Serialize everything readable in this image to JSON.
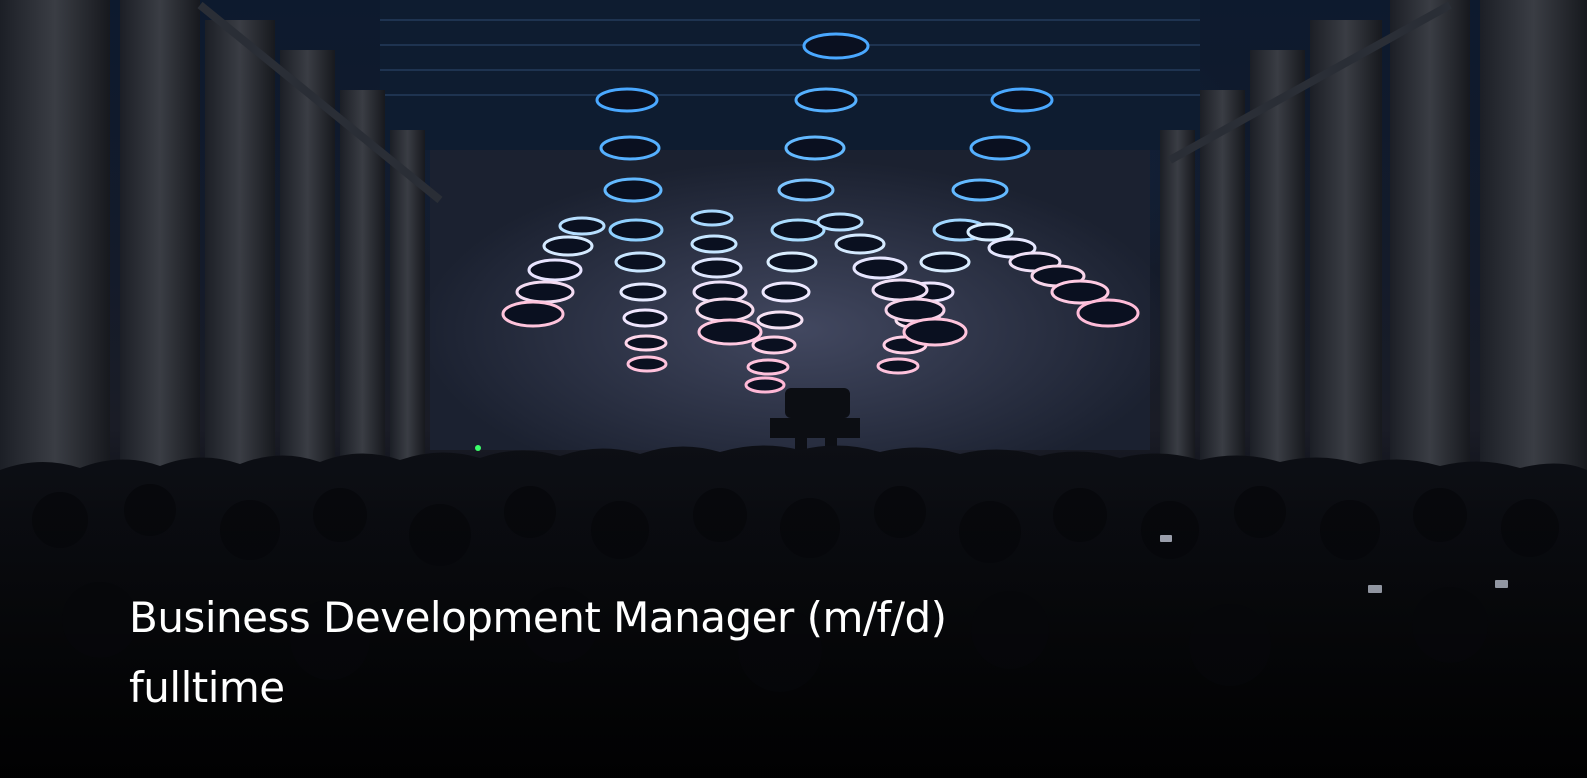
{
  "hero": {
    "image": "concert-hall-light-installation-photo"
  },
  "job": {
    "title": "Business Development Manager (m/f/d)",
    "employment_type": "fulltime"
  },
  "colors": {
    "text": "#ffffff",
    "glow_blue": "#5fb8ff",
    "glow_pink": "#ffb4d2"
  }
}
